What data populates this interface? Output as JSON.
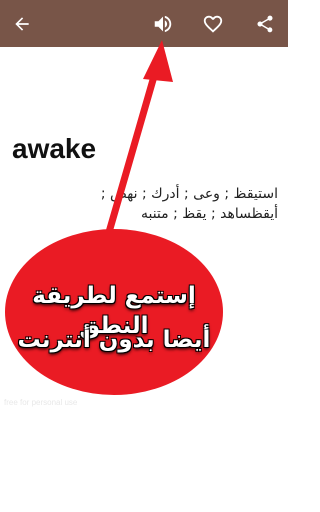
{
  "toolbar": {
    "background": "#785548",
    "icons": [
      "back-arrow-icon",
      "speaker-icon",
      "heart-icon",
      "share-icon"
    ]
  },
  "entry": {
    "word": "awake",
    "meaning_line1": "استيقظ ; وعى ; أدرك ; نهض ;",
    "meaning_line2": "أيقظساهد ; يقظ ; متنبه"
  },
  "promo": {
    "line1": "إستمع لطريقة النطق",
    "line2": "أيضا بدون أنترنت",
    "color": "#ea1b24"
  },
  "watermark": "free for personal use"
}
